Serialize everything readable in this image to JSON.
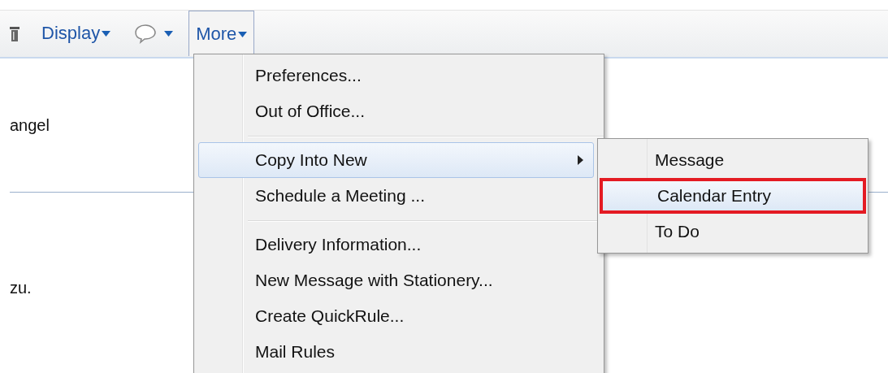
{
  "toolbar": {
    "items": [
      {
        "kind": "partial_icon"
      },
      {
        "kind": "dropdown",
        "label": "Display",
        "selected": false
      },
      {
        "kind": "icon_dropdown",
        "selected": false
      },
      {
        "kind": "dropdown",
        "label": "More",
        "selected": true
      }
    ]
  },
  "body": {
    "lines": [
      "angel",
      "zu."
    ]
  },
  "menu": {
    "items": [
      {
        "kind": "item",
        "label": "Preferences...",
        "highlighted": false,
        "submenu": false
      },
      {
        "kind": "item",
        "label": "Out of Office...",
        "highlighted": false,
        "submenu": false
      },
      {
        "kind": "separator"
      },
      {
        "kind": "item",
        "label": "Copy Into New",
        "highlighted": true,
        "submenu": true
      },
      {
        "kind": "item",
        "label": "Schedule a Meeting ...",
        "highlighted": false,
        "submenu": false
      },
      {
        "kind": "separator"
      },
      {
        "kind": "item",
        "label": "Delivery Information...",
        "highlighted": false,
        "submenu": false
      },
      {
        "kind": "item",
        "label": "New Message with Stationery...",
        "highlighted": false,
        "submenu": false
      },
      {
        "kind": "item",
        "label": "Create QuickRule...",
        "highlighted": false,
        "submenu": false
      },
      {
        "kind": "item",
        "label": "Mail Rules",
        "highlighted": false,
        "submenu": false
      }
    ]
  },
  "submenu": {
    "items": [
      {
        "label": "Message",
        "highlighted": false,
        "outlined": false
      },
      {
        "label": "Calendar Entry",
        "highlighted": true,
        "outlined": true
      },
      {
        "label": "To Do",
        "highlighted": false,
        "outlined": false
      }
    ]
  }
}
